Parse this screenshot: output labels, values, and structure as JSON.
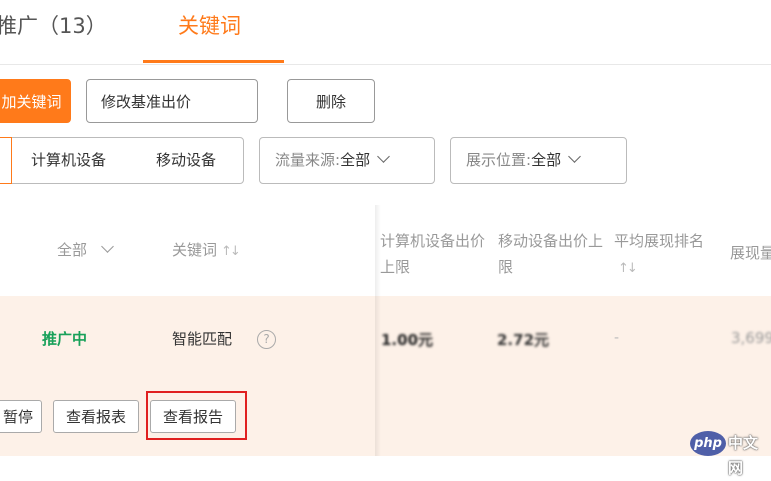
{
  "tabs": [
    {
      "label": "推广（13）"
    },
    {
      "label": "关键词"
    }
  ],
  "toolbar": {
    "add_label": "加关键词",
    "modify_label": "修改基准出价",
    "warning_symbol": "!",
    "delete_label": "删除"
  },
  "filters": {
    "device_options": [
      "计算机设备",
      "移动设备"
    ],
    "traffic_label": "流量来源:",
    "traffic_value": "全部",
    "position_label": "展示位置:",
    "position_value": "全部"
  },
  "table": {
    "status_filter": "全部",
    "headers": {
      "keyword": "关键词",
      "pc_bid": "计算机设备出价上限",
      "mobile_bid": "移动设备出价上限",
      "avg_rank": "平均展现排名",
      "impressions": "展现量"
    },
    "sort_icon": "↑↓",
    "row": {
      "status": "推广中",
      "keyword": "智能匹配",
      "help_symbol": "?",
      "pc_bid": "1.00元",
      "mobile_bid": "2.72元",
      "avg_rank": "-",
      "impressions": "3,699"
    },
    "actions": [
      "暂停",
      "查看报表",
      "查看报告"
    ]
  },
  "watermark": {
    "logo": "php",
    "text": "中文网"
  },
  "colors": {
    "accent": "#ff7a1a",
    "status_green": "#19a15a",
    "highlight_red": "#e02020",
    "row_bg": "#fdf1e8"
  }
}
